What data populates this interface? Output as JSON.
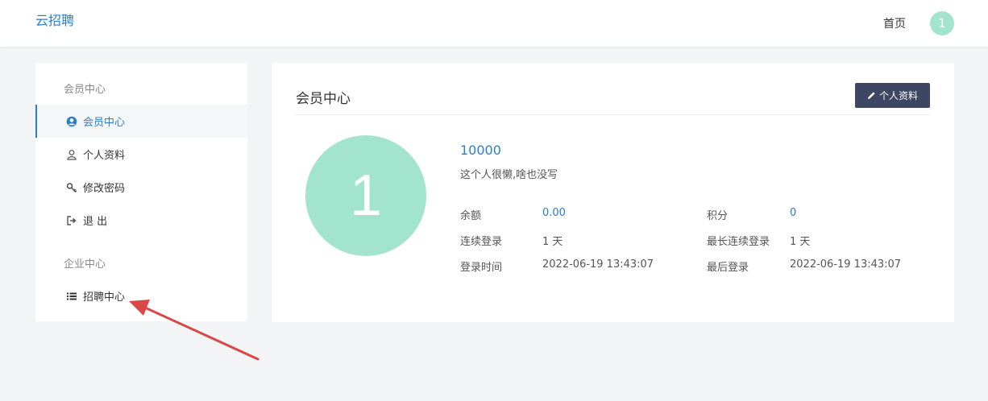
{
  "header": {
    "logo": "云招聘",
    "home_link": "首页",
    "avatar_text": "1",
    "avatar_color": "#a3e4cf"
  },
  "sidebar": {
    "group1": "会员中心",
    "items": [
      {
        "label": "会员中心",
        "icon": "user-circle-icon",
        "active": true
      },
      {
        "label": "个人资料",
        "icon": "user-icon",
        "active": false
      },
      {
        "label": "修改密码",
        "icon": "key-icon",
        "active": false
      },
      {
        "label": "退 出",
        "icon": "sign-out-icon",
        "active": false
      }
    ],
    "group2": "企业中心",
    "items2": [
      {
        "label": "招聘中心",
        "icon": "list-icon",
        "active": false
      }
    ]
  },
  "main": {
    "title": "会员中心",
    "profile_button": "个人资料",
    "avatar_text": "1",
    "username": "10000",
    "bio": "这个人很懒,啥也没写",
    "stats": {
      "balance_label": "余额",
      "balance_value": "0.00",
      "points_label": "积分",
      "points_value": "0",
      "streak_label": "连续登录",
      "streak_value": "1 天",
      "max_streak_label": "最长连续登录",
      "max_streak_value": "1 天",
      "login_time_label": "登录时间",
      "login_time_value": "2022-06-19 13:43:07",
      "last_login_label": "最后登录",
      "last_login_value": "2022-06-19 13:43:07"
    }
  },
  "colors": {
    "accent": "#2a7fc7",
    "button_dark": "#3d4662",
    "annotation_arrow": "#d94848"
  }
}
